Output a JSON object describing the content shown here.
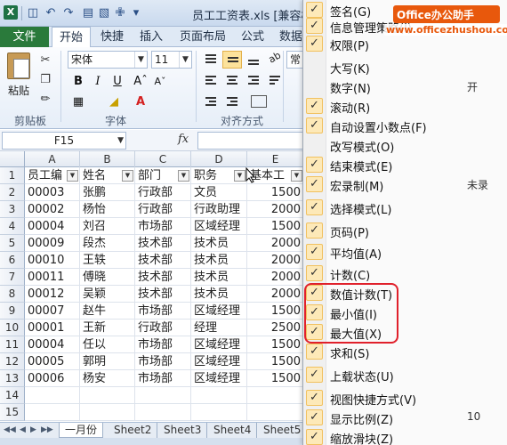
{
  "window": {
    "title": "员工工资表.xls  [兼容模"
  },
  "ribbon": {
    "file_tab": "文件",
    "tabs": [
      "开始",
      "快捷",
      "插入",
      "页面布局",
      "公式",
      "数据"
    ],
    "active_tab": "开始",
    "paste_label": "粘贴",
    "font_name": "宋体",
    "font_size": "11",
    "number_format": "常规",
    "groups": [
      "剪贴板",
      "字体",
      "对齐方式"
    ]
  },
  "formula_bar": {
    "name_box": "F15",
    "fx_label": "fx",
    "formula": ""
  },
  "columns": [
    "A",
    "B",
    "C",
    "D",
    "E"
  ],
  "rows": [
    "1",
    "2",
    "3",
    "4",
    "5",
    "6",
    "7",
    "8",
    "9",
    "10",
    "11",
    "12",
    "13",
    "14",
    "15"
  ],
  "table": {
    "headers": [
      "员工编",
      "姓名",
      "部门",
      "职务",
      "基本工"
    ],
    "rows": [
      [
        "00003",
        "张鹏",
        "行政部",
        "文员",
        "1500"
      ],
      [
        "00002",
        "杨怡",
        "行政部",
        "行政助理",
        "2000"
      ],
      [
        "00004",
        "刘召",
        "市场部",
        "区域经理",
        "1500"
      ],
      [
        "00009",
        "段杰",
        "技术部",
        "技术员",
        "2000"
      ],
      [
        "00010",
        "王轶",
        "技术部",
        "技术员",
        "2000"
      ],
      [
        "00011",
        "傅晓",
        "技术部",
        "技术员",
        "2000"
      ],
      [
        "00012",
        "吴颖",
        "技术部",
        "技术员",
        "2000"
      ],
      [
        "00007",
        "赵牛",
        "市场部",
        "区域经理",
        "1500"
      ],
      [
        "00001",
        "王新",
        "行政部",
        "经理",
        "2500"
      ],
      [
        "00004",
        "任以",
        "市场部",
        "区域经理",
        "1500"
      ],
      [
        "00005",
        "郭明",
        "市场部",
        "区域经理",
        "1500"
      ],
      [
        "00006",
        "杨安",
        "市场部",
        "区域经理",
        "1500"
      ]
    ]
  },
  "sheets": [
    "一月份",
    "Sheet2",
    "Sheet3",
    "Sheet4",
    "Sheet5"
  ],
  "active_sheet": "一月份",
  "status_menu": {
    "items": [
      {
        "label": "签名(G)",
        "checked": true,
        "value": ""
      },
      {
        "label": "信息管理策略(I)",
        "checked": true,
        "value": ""
      },
      {
        "label": "权限(P)",
        "checked": true,
        "value": ""
      },
      {
        "label": "大写(K)",
        "checked": false,
        "value": ""
      },
      {
        "label": "数字(N)",
        "checked": false,
        "value": "开"
      },
      {
        "label": "滚动(R)",
        "checked": true,
        "value": ""
      },
      {
        "label": "自动设置小数点(F)",
        "checked": true,
        "value": ""
      },
      {
        "label": "改写模式(O)",
        "checked": false,
        "value": ""
      },
      {
        "label": "结束模式(E)",
        "checked": true,
        "value": ""
      },
      {
        "label": "宏录制(M)",
        "checked": true,
        "value": "未录"
      },
      {
        "label": "选择模式(L)",
        "checked": true,
        "value": ""
      },
      {
        "label": "页码(P)",
        "checked": true,
        "value": ""
      },
      {
        "label": "平均值(A)",
        "checked": true,
        "value": ""
      },
      {
        "label": "计数(C)",
        "checked": true,
        "value": ""
      },
      {
        "label": "数值计数(T)",
        "checked": true,
        "value": ""
      },
      {
        "label": "最小值(I)",
        "checked": true,
        "value": ""
      },
      {
        "label": "最大值(X)",
        "checked": true,
        "value": ""
      },
      {
        "label": "求和(S)",
        "checked": true,
        "value": ""
      },
      {
        "label": "上载状态(U)",
        "checked": true,
        "value": ""
      },
      {
        "label": "视图快捷方式(V)",
        "checked": true,
        "value": ""
      },
      {
        "label": "显示比例(Z)",
        "checked": true,
        "value": "10"
      },
      {
        "label": "缩放滑块(Z)",
        "checked": true,
        "value": ""
      }
    ]
  },
  "watermark": {
    "title": "Office办公助手",
    "url": "www.officezhushou.com"
  },
  "colors": {
    "file_tab": "#2a7a3b",
    "highlight": "#e0202b",
    "watermark": "#e8580c"
  }
}
